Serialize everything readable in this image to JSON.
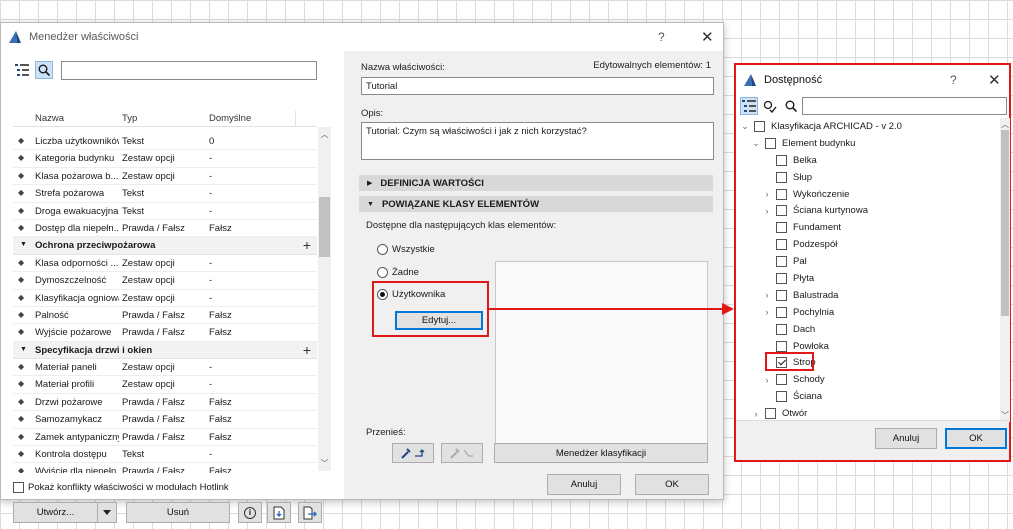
{
  "main_dialog": {
    "title": "Menedżer właściwości",
    "help_glyph": "?",
    "close_glyph": "✕",
    "search_value": "",
    "columns": {
      "name": "Nazwa",
      "type": "Typ",
      "default": "Domyślne"
    },
    "rows": [
      {
        "kind": "prop",
        "name": "Liczba użytkowników",
        "type": "Tekst",
        "default": "0"
      },
      {
        "kind": "prop",
        "name": "Kategoria budynku",
        "type": "Zestaw opcji",
        "default": "-"
      },
      {
        "kind": "prop",
        "name": "Klasa pożarowa b...",
        "type": "Zestaw opcji",
        "default": "-"
      },
      {
        "kind": "prop",
        "name": "Strefa pożarowa",
        "type": "Tekst",
        "default": "-"
      },
      {
        "kind": "prop",
        "name": "Droga ewakuacyjna",
        "type": "Tekst",
        "default": "-"
      },
      {
        "kind": "prop",
        "name": "Dostęp dla niepełn...",
        "type": "Prawda / Fałsz",
        "default": "Fałsz"
      },
      {
        "kind": "group",
        "name": "Ochrona przeciwpożarowa",
        "plus": "+"
      },
      {
        "kind": "prop",
        "name": "Klasa odporności ...",
        "type": "Zestaw opcji",
        "default": "-"
      },
      {
        "kind": "prop",
        "name": "Dymoszczelność",
        "type": "Zestaw opcji",
        "default": "-"
      },
      {
        "kind": "prop",
        "name": "Klasyfikacja ogniowa",
        "type": "Zestaw opcji",
        "default": "-"
      },
      {
        "kind": "prop",
        "name": "Palność",
        "type": "Prawda / Fałsz",
        "default": "Fałsz"
      },
      {
        "kind": "prop",
        "name": "Wyjście pożarowe",
        "type": "Prawda / Fałsz",
        "default": "Fałsz"
      },
      {
        "kind": "group",
        "name": "Specyfikacja drzwi i okien",
        "plus": "+"
      },
      {
        "kind": "prop",
        "name": "Materiał paneli",
        "type": "Zestaw opcji",
        "default": "-"
      },
      {
        "kind": "prop",
        "name": "Materiał profili",
        "type": "Zestaw opcji",
        "default": "-"
      },
      {
        "kind": "prop",
        "name": "Drzwi pożarowe",
        "type": "Prawda / Fałsz",
        "default": "Fałsz"
      },
      {
        "kind": "prop",
        "name": "Samozamykacz",
        "type": "Prawda / Fałsz",
        "default": "Fałsz"
      },
      {
        "kind": "prop",
        "name": "Zamek antypaniczny",
        "type": "Prawda / Fałsz",
        "default": "Fałsz"
      },
      {
        "kind": "prop",
        "name": "Kontrola dostępu",
        "type": "Tekst",
        "default": "-"
      },
      {
        "kind": "prop",
        "name": "Wyjście dla niepełn...",
        "type": "Prawda / Fałsz",
        "default": "Fałsz"
      }
    ],
    "hotlink_label": "Pokaż konflikty właściwości w modułach Hotlink",
    "create_label": "Utwórz...",
    "delete_label": "Usuń",
    "info_glyph": "i",
    "name_field_label": "Nazwa właściwości:",
    "name_value": "Tutorial",
    "editable_count_label": "Edytowalnych elementów: 1",
    "description_label": "Opis:",
    "description_value": "Tutorial: Czym są właściwości i jak z nich korzystać?",
    "section_values": "DEFINICJA WARTOŚCI",
    "section_classes": "POWIĄZANE KLASY ELEMENTÓW",
    "available_for_label": "Dostępne dla następujących klas elementów:",
    "radio_all": "Wszystkie",
    "radio_none": "Żadne",
    "radio_custom": "Użytkownika",
    "edit_button": "Edytuj...",
    "transfer_label": "Przenieś:",
    "class_manager_button": "Menedżer klasyfikacji",
    "cancel_label": "Anuluj",
    "ok_label": "OK"
  },
  "availability_dialog": {
    "title": "Dostępność",
    "help_glyph": "?",
    "close_glyph": "✕",
    "search_value": "",
    "tree": [
      {
        "level": 0,
        "expander": "collapse",
        "checked": false,
        "label": "Klasyfikacja ARCHICAD - v 2.0"
      },
      {
        "level": 1,
        "expander": "collapse",
        "checked": false,
        "label": "Element budynku"
      },
      {
        "level": 2,
        "expander": "none",
        "checked": false,
        "label": "Belka"
      },
      {
        "level": 2,
        "expander": "none",
        "checked": false,
        "label": "Słup"
      },
      {
        "level": 2,
        "expander": "expand",
        "checked": false,
        "label": "Wykończenie"
      },
      {
        "level": 2,
        "expander": "expand",
        "checked": false,
        "label": "Ściana kurtynowa"
      },
      {
        "level": 2,
        "expander": "none",
        "checked": false,
        "label": "Fundament"
      },
      {
        "level": 2,
        "expander": "none",
        "checked": false,
        "label": "Podzespół"
      },
      {
        "level": 2,
        "expander": "none",
        "checked": false,
        "label": "Pal"
      },
      {
        "level": 2,
        "expander": "none",
        "checked": false,
        "label": "Płyta"
      },
      {
        "level": 2,
        "expander": "expand",
        "checked": false,
        "label": "Balustrada"
      },
      {
        "level": 2,
        "expander": "expand",
        "checked": false,
        "label": "Pochylnia"
      },
      {
        "level": 2,
        "expander": "none",
        "checked": false,
        "label": "Dach"
      },
      {
        "level": 2,
        "expander": "none",
        "checked": false,
        "label": "Powłoka"
      },
      {
        "level": 2,
        "expander": "none",
        "checked": true,
        "label": "Strop"
      },
      {
        "level": 2,
        "expander": "expand",
        "checked": false,
        "label": "Schody"
      },
      {
        "level": 2,
        "expander": "none",
        "checked": false,
        "label": "Ściana"
      },
      {
        "level": 1,
        "expander": "expand",
        "checked": false,
        "label": "Otwór"
      }
    ],
    "cancel_label": "Anuluj",
    "ok_label": "OK"
  },
  "colors": {
    "highlight": "#e01818",
    "focus": "#0078d7",
    "section_bar": "#d8d8d8"
  }
}
